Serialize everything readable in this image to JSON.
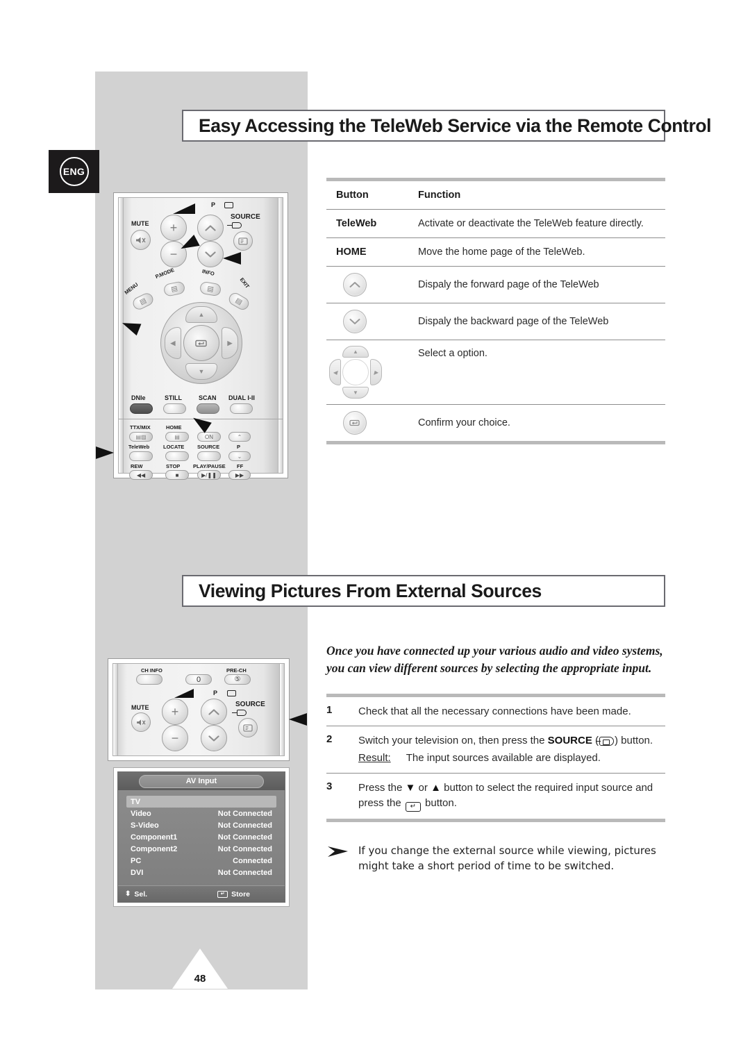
{
  "page": {
    "language_tab": "ENG",
    "page_number": "48"
  },
  "sections": {
    "teleweb": {
      "title": "Easy Accessing the TeleWeb Service via the Remote Control",
      "table": {
        "headers": [
          "Button",
          "Function"
        ],
        "rows": [
          {
            "button_label": "TeleWeb",
            "button_icon": "",
            "function": "Activate or deactivate the TeleWeb feature directly."
          },
          {
            "button_label": "HOME",
            "button_icon": "",
            "function": "Move the home page of the TeleWeb."
          },
          {
            "button_label": "",
            "button_icon": "chevron-up-key-icon",
            "function": "Dispaly the forward page of the TeleWeb"
          },
          {
            "button_label": "",
            "button_icon": "chevron-down-key-icon",
            "function": "Dispaly the backward page of the TeleWeb"
          },
          {
            "button_label": "",
            "button_icon": "four-way-navigation-ring-icon",
            "function": "Select a option."
          },
          {
            "button_label": "",
            "button_icon": "enter-key-icon",
            "function": "Confirm your choice."
          }
        ]
      }
    },
    "external_sources": {
      "title": "Viewing Pictures From External Sources",
      "intro_line1": "Once you have connected up your various audio and video systems,",
      "intro_line2": "you can view different sources by selecting the appropriate input.",
      "steps": [
        {
          "number": "1",
          "text": "Check that all the necessary connections have been made.",
          "result_label": "",
          "result_text": ""
        },
        {
          "number": "2",
          "text_a": "Switch your television on, then press the ",
          "bold": "SOURCE",
          "text_b": " (",
          "text_c": ") button.",
          "result_label": "Result:",
          "result_text": "The input sources available are displayed."
        },
        {
          "number": "3",
          "text_a": "Press the ",
          "down": "▼",
          "text_b": " or ",
          "up": "▲",
          "text_c": " button to select the required input source and",
          "text_d": "press the ",
          "text_e": " button."
        }
      ],
      "note_line1": "If you change the external source while viewing, pictures",
      "note_line2": "might take a short period of time to be switched."
    }
  },
  "remote_top": {
    "labels": {
      "mute": "MUTE",
      "p": "P",
      "source": "SOURCE",
      "menu": "MENU",
      "pmode": "P.MODE",
      "info": "INFO",
      "exit": "EXIT",
      "dnie": "DNIe",
      "still": "STILL",
      "scan": "SCAN",
      "dual": "DUAL I-II",
      "ttxmix": "TTX/MIX",
      "home": "HOME",
      "on": "ON",
      "teleweb": "TeleWeb",
      "locate": "LOCATE",
      "source2": "SOURCE",
      "p2": "P",
      "rew": "REW",
      "stop": "STOP",
      "playpause": "PLAY/PAUSE",
      "ff": "FF"
    }
  },
  "remote_bottom": {
    "labels": {
      "ch_info": "CH INFO",
      "zero": "0",
      "pre_ch": "PRE-CH",
      "mute": "MUTE",
      "p": "P",
      "source": "SOURCE"
    }
  },
  "osd": {
    "title": "AV Input",
    "rows": [
      {
        "name": "TV",
        "status": "",
        "selected": true
      },
      {
        "name": "Video",
        "status": "Not Connected",
        "selected": false
      },
      {
        "name": "S-Video",
        "status": "Not Connected",
        "selected": false
      },
      {
        "name": "Component1",
        "status": "Not Connected",
        "selected": false
      },
      {
        "name": "Component2",
        "status": "Not Connected",
        "selected": false
      },
      {
        "name": "PC",
        "status": "Connected",
        "selected": false
      },
      {
        "name": "DVI",
        "status": "Not Connected",
        "selected": false
      }
    ],
    "footer": {
      "select": "Sel.",
      "store": "Store"
    }
  },
  "colors": {
    "panel_gray": "#d2d2d2",
    "title_border": "#6a6a70",
    "rule_gray": "#b9b9b9",
    "rule_thin": "#8c8c8c",
    "osd_bg": "#7d7d7d",
    "osd_highlight": "#b8b8b8"
  }
}
